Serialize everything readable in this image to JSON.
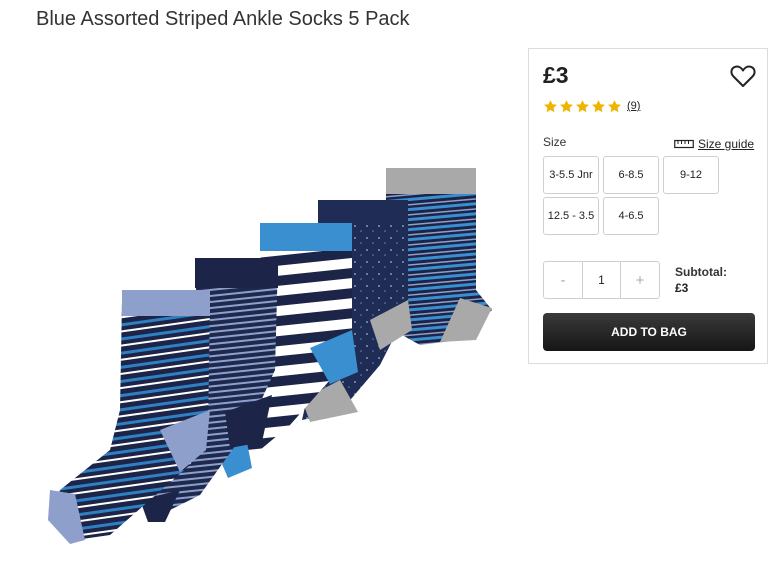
{
  "product": {
    "title": "Blue Assorted Striped Ankle Socks 5 Pack",
    "price": "£3",
    "rating": 5,
    "review_count": "(9)"
  },
  "size": {
    "label": "Size",
    "guide_label": "Size guide",
    "options": [
      "3-5.5 Jnr",
      "6-8.5",
      "9-12",
      "12.5 - 3.5",
      "4-6.5"
    ]
  },
  "quantity": {
    "minus": "-",
    "value": "1",
    "plus": "+"
  },
  "subtotal": {
    "label": "Subtotal:",
    "value": "£3"
  },
  "actions": {
    "add_to_bag": "ADD TO BAG"
  },
  "icons": {
    "favourite": "heart-outline-icon",
    "rating_star": "star-icon",
    "size_guide": "ruler-icon"
  },
  "colors": {
    "star": "#f0b400",
    "button": "#222222",
    "navy": "#1c2547",
    "sky": "#3a8fd0",
    "periwinkle": "#8e9fcc",
    "grey": "#a9a9a9"
  }
}
